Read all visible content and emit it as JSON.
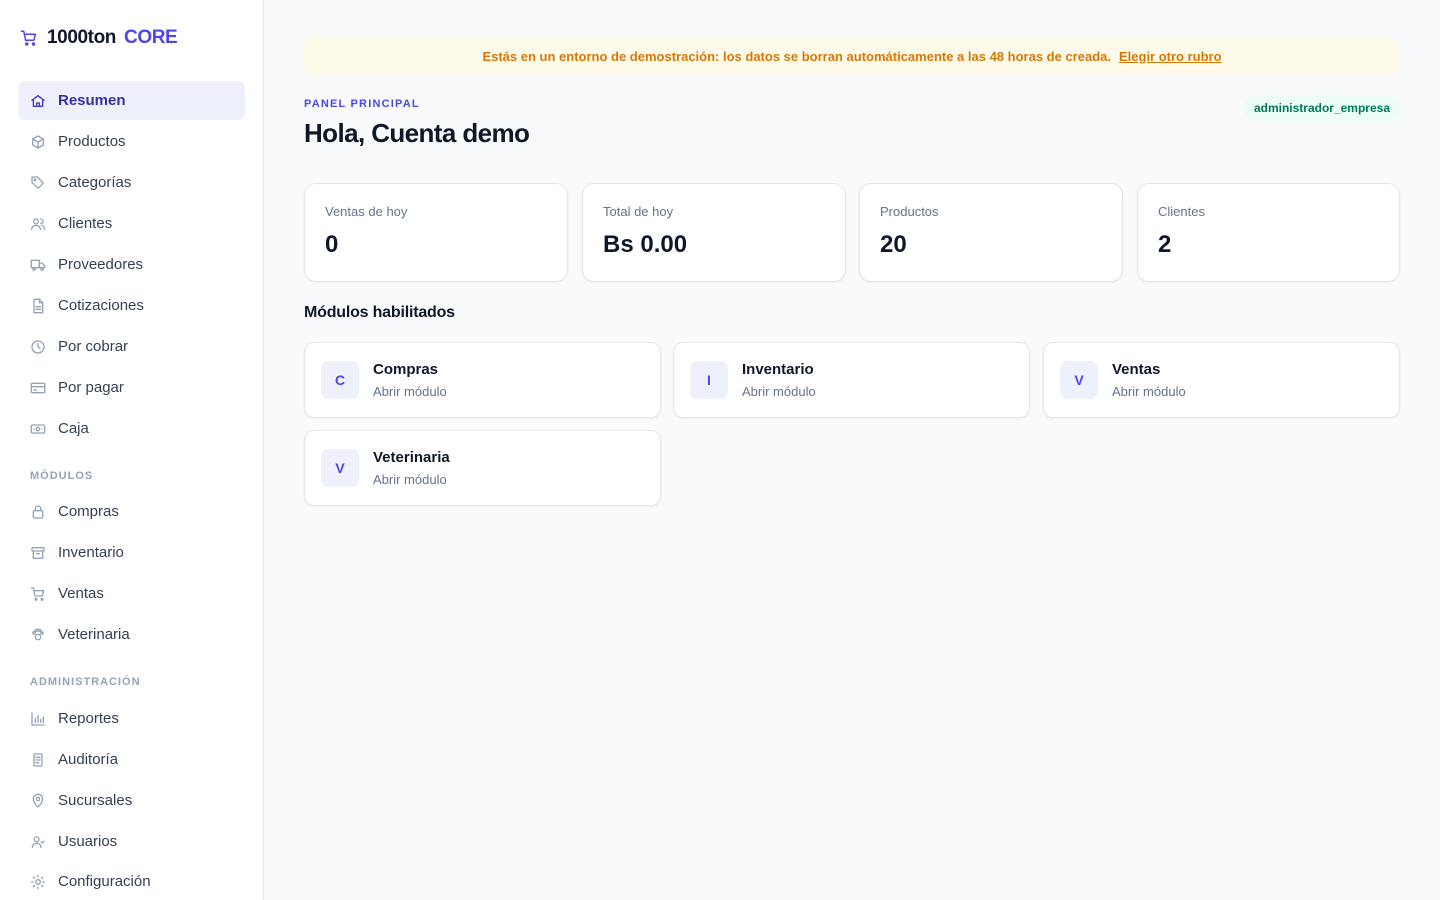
{
  "brand": {
    "name": "1000ton",
    "suffix": "CORE",
    "icon": "cart-icon"
  },
  "sidebar": {
    "main": [
      {
        "label": "Resumen",
        "icon": "home-icon",
        "active": true
      },
      {
        "label": "Productos",
        "icon": "box-icon"
      },
      {
        "label": "Categorías",
        "icon": "tag-icon"
      },
      {
        "label": "Clientes",
        "icon": "users-icon"
      },
      {
        "label": "Proveedores",
        "icon": "truck-icon"
      },
      {
        "label": "Cotizaciones",
        "icon": "file-icon"
      },
      {
        "label": "Por cobrar",
        "icon": "clock-icon"
      },
      {
        "label": "Por pagar",
        "icon": "card-icon"
      },
      {
        "label": "Caja",
        "icon": "cash-icon"
      }
    ],
    "modules_heading": "MÓDULOS",
    "modules": [
      {
        "label": "Compras",
        "icon": "bag-icon"
      },
      {
        "label": "Inventario",
        "icon": "archive-icon"
      },
      {
        "label": "Ventas",
        "icon": "cart-icon"
      },
      {
        "label": "Veterinaria",
        "icon": "paw-icon"
      }
    ],
    "admin_heading": "ADMINISTRACIÓN",
    "admin": [
      {
        "label": "Reportes",
        "icon": "bar-chart-icon"
      },
      {
        "label": "Auditoría",
        "icon": "clipboard-icon"
      },
      {
        "label": "Sucursales",
        "icon": "map-pin-icon"
      },
      {
        "label": "Usuarios",
        "icon": "user-icon"
      },
      {
        "label": "Configuración",
        "icon": "sun-gear-icon"
      }
    ]
  },
  "banner": {
    "text": "Estás en un entorno de demostración: los datos se borran automáticamente a las 48 horas de creada.",
    "link": "Elegir otro rubro"
  },
  "header": {
    "eyebrow": "PANEL PRINCIPAL",
    "title": "Hola, Cuenta demo",
    "role": "administrador_empresa"
  },
  "stats": [
    {
      "label": "Ventas de hoy",
      "value": "0"
    },
    {
      "label": "Total de hoy",
      "value": "Bs 0.00"
    },
    {
      "label": "Productos",
      "value": "20"
    },
    {
      "label": "Clientes",
      "value": "2"
    }
  ],
  "modules_section": {
    "title": "Módulos habilitados",
    "items": [
      {
        "initial": "C",
        "name": "Compras",
        "action": "Abrir módulo"
      },
      {
        "initial": "I",
        "name": "Inventario",
        "action": "Abrir módulo"
      },
      {
        "initial": "V",
        "name": "Ventas",
        "action": "Abrir módulo"
      },
      {
        "initial": "V",
        "name": "Veterinaria",
        "action": "Abrir módulo"
      }
    ]
  },
  "colors": {
    "accent": "#4f46e5",
    "banner_text": "#d97706",
    "badge_text": "#047857"
  }
}
